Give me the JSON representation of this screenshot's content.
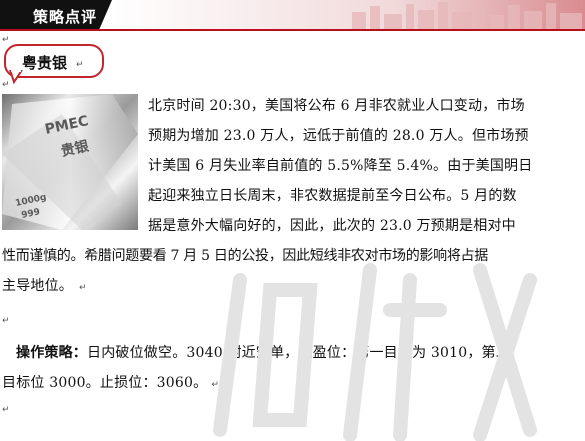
{
  "header": {
    "title": "策略点评"
  },
  "callout": {
    "label": "粤贵银"
  },
  "paragraph_mark": "↵",
  "photo": {
    "text_top": "PMEC",
    "text_mid": "贵银",
    "text_low": "1000g",
    "text_low2": "999"
  },
  "body": {
    "lines": [
      "北京时间 20:30，美国将公布 6 月非农就业人口变动，市场",
      "预期为增加 23.0 万人，远低于前值的 28.0 万人。但市场预",
      "计美国 6 月失业率自前值的 5.5%降至 5.4%。由于美国明日",
      "起迎来独立日长周末，非农数据提前至今日公布。5 月的数",
      "据是意外大幅向好的，因此，此次的 23.0 万预期是相对中",
      "性而谨慎的。希腊问题要看 7 月 5 日的公投，因此短线非农对市场的影响将占据",
      "主导地位。"
    ]
  },
  "strategy": {
    "label": "操作策略：",
    "line1": "日内破位做空。3040 附近空单，止盈位：第一目标为 3010，第二",
    "line2": "目标位 3000。止损位：3060。"
  }
}
